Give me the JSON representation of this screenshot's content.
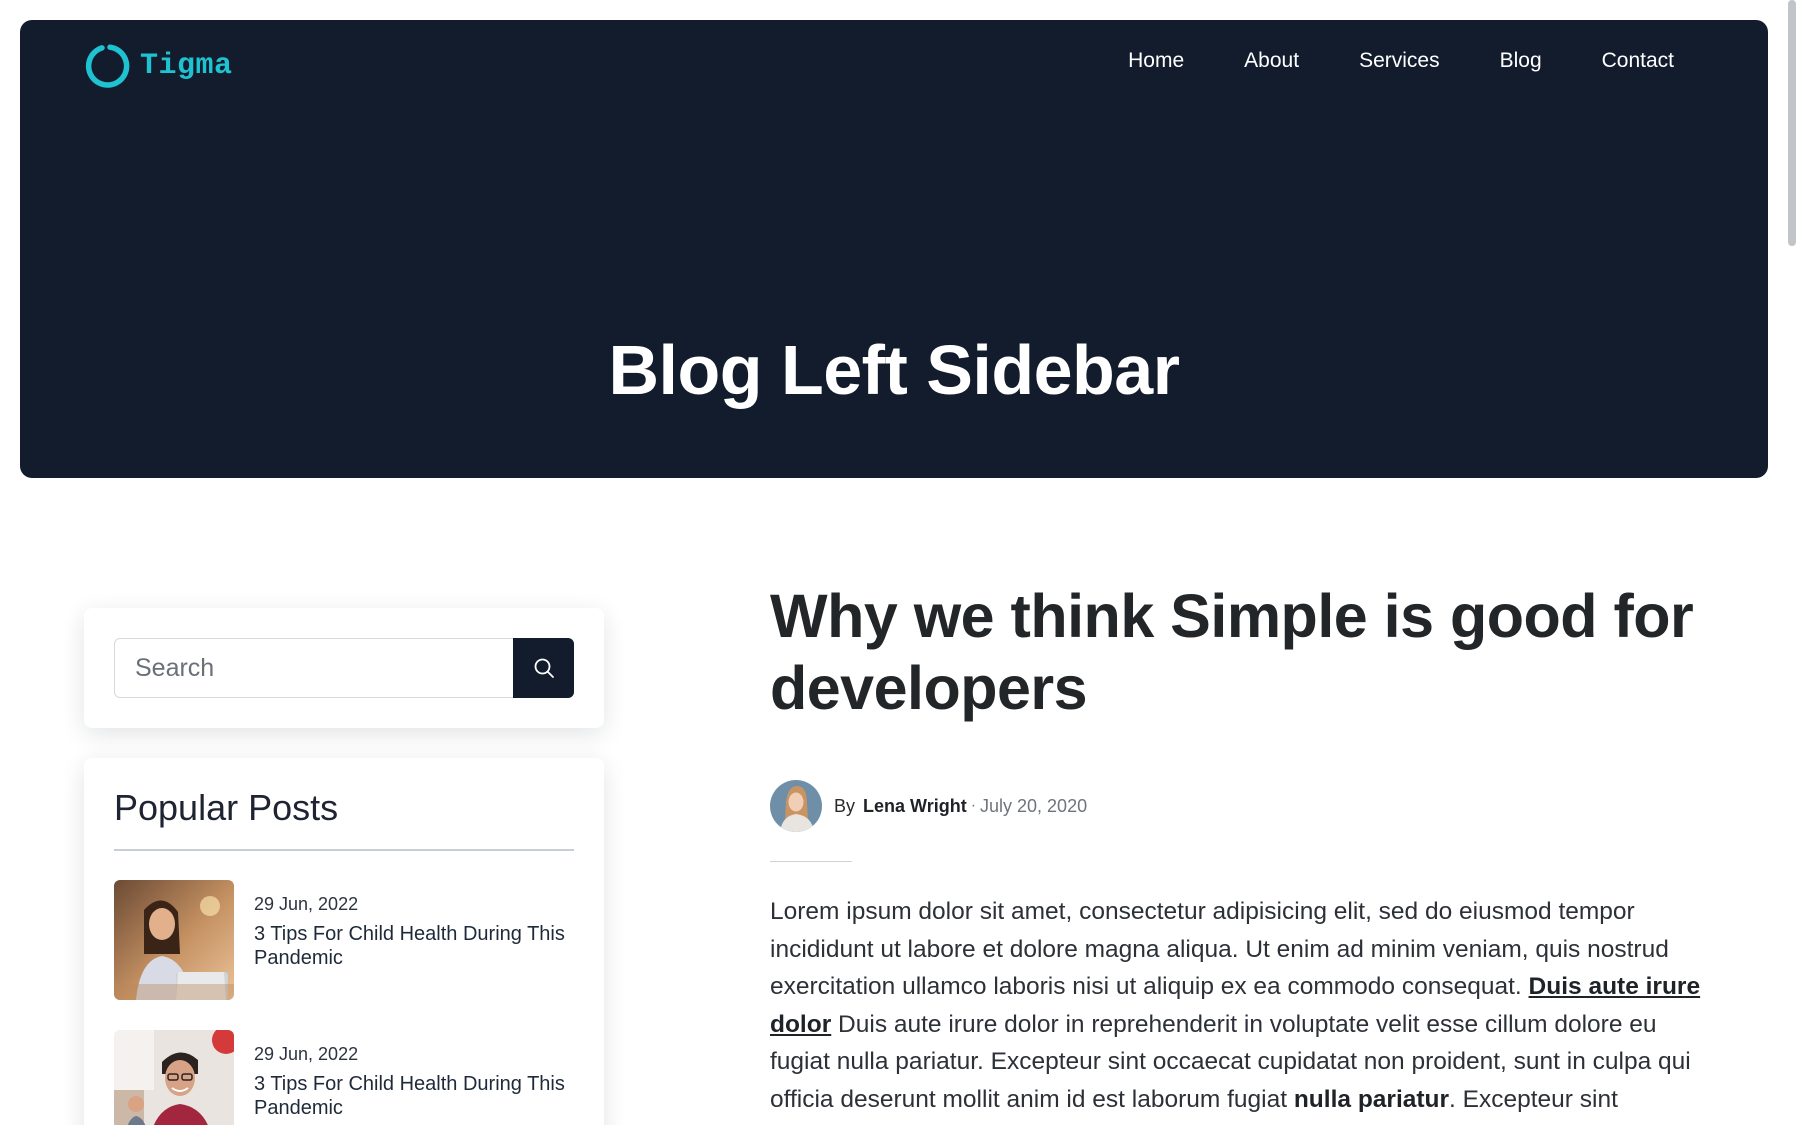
{
  "brand": {
    "name": "Tigma",
    "accent_color": "#1fc2d1"
  },
  "nav": {
    "items": [
      "Home",
      "About",
      "Services",
      "Blog",
      "Contact"
    ]
  },
  "hero": {
    "title": "Blog Left Sidebar",
    "background_color": "#121c2d"
  },
  "sidebar": {
    "search": {
      "placeholder": "Search",
      "button_icon": "search-icon"
    },
    "popular_posts": {
      "title": "Popular Posts",
      "items": [
        {
          "date": "29 Jun, 2022",
          "title": "3 Tips For Child Health During This Pandemic"
        },
        {
          "date": "29 Jun, 2022",
          "title": "3 Tips For Child Health During This Pandemic"
        }
      ]
    }
  },
  "article": {
    "title": "Why we think Simple is good for developers",
    "byline": {
      "by_label": "By",
      "author": "Lena Wright",
      "separator": "·",
      "date": "July 20, 2020"
    },
    "body": {
      "text_1": "Lorem ipsum dolor sit amet, consectetur adipisicing elit, sed do eiusmod tempor incididunt ut labore et dolore magna aliqua. Ut enim ad minim veniam, quis nostrud exercitation ullamco laboris nisi ut aliquip ex ea commodo consequat. ",
      "link": "Duis aute irure dolor",
      "text_2": " Duis aute irure dolor in reprehenderit in voluptate velit esse cillum dolore eu fugiat nulla pariatur. Excepteur sint occaecat cupidatat non proident, sunt in culpa qui officia deserunt mollit anim id est laborum fugiat ",
      "bold": "nulla pariatur",
      "text_3": ". Excepteur sint"
    }
  }
}
